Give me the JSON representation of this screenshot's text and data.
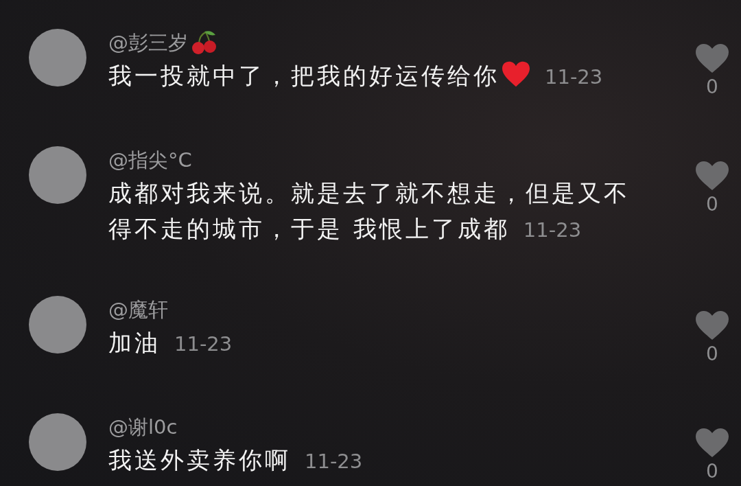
{
  "comments": [
    {
      "username": "@彭三岁",
      "name_icon": {
        "kind": "cherry"
      },
      "text": "我一投就中了，把我的好运传给你",
      "text_icon": {
        "kind": "heart"
      },
      "date": "11-23",
      "likes": "0"
    },
    {
      "username": "@指尖°C",
      "text": "成都对我来说。就是去了就不想走，但是又不得不走的城市，于是 我恨上了成都",
      "date": "11-23",
      "likes": "0"
    },
    {
      "username": "@魔轩",
      "text": "加油",
      "date": "11-23",
      "likes": "0"
    },
    {
      "username": "@谢l0c",
      "text": "我送外卖养你啊",
      "date": "11-23",
      "likes": "0"
    }
  ]
}
